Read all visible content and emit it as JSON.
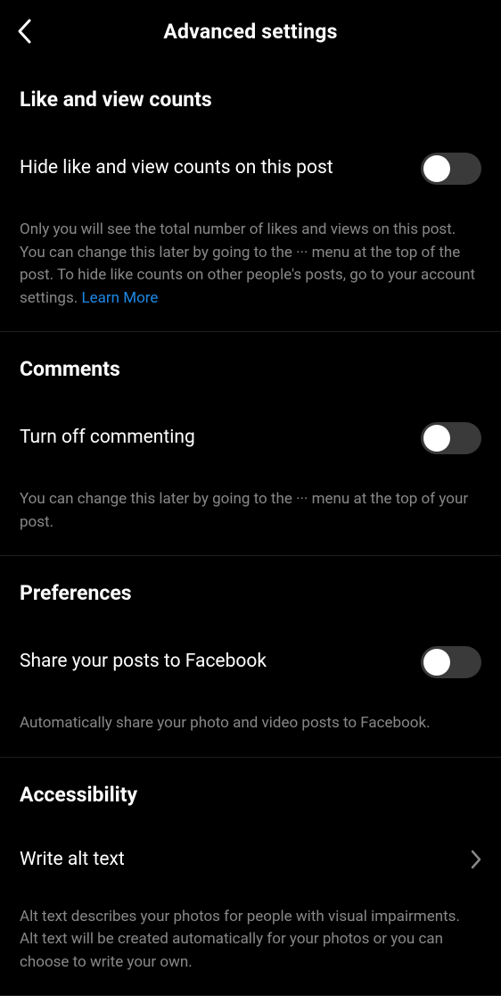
{
  "header": {
    "title": "Advanced settings"
  },
  "sections": {
    "likes": {
      "title": "Like and view counts",
      "toggle_label": "Hide like and view counts on this post",
      "description": "Only you will see the total number of likes and views on this post. You can change this later by going to the ··· menu at the top of the post. To hide like counts on other people's posts, go to your account settings. ",
      "learn_more": "Learn More"
    },
    "comments": {
      "title": "Comments",
      "toggle_label": "Turn off commenting",
      "description": "You can change this later by going to the ··· menu at the top of your post."
    },
    "preferences": {
      "title": "Preferences",
      "toggle_label": "Share your posts to Facebook",
      "description": "Automatically share your photo and video posts to Facebook."
    },
    "accessibility": {
      "title": "Accessibility",
      "row_label": "Write alt text",
      "description": "Alt text describes your photos for people with visual impairments. Alt text will be created automatically for your photos or you can choose to write your own."
    }
  }
}
